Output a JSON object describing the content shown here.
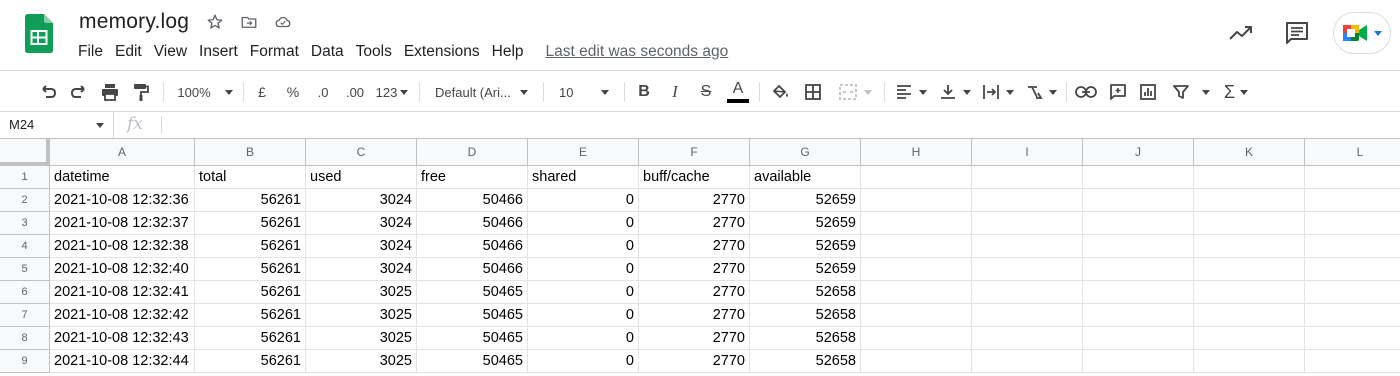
{
  "document": {
    "title": "memory.log",
    "last_edit": "Last edit was seconds ago"
  },
  "menu": [
    "File",
    "Edit",
    "View",
    "Insert",
    "Format",
    "Data",
    "Tools",
    "Extensions",
    "Help"
  ],
  "toolbar": {
    "zoom": "100%",
    "currency": "£",
    "percent": "%",
    "decimal_decrease": ".0",
    "decimal_increase": ".00",
    "more_formats": "123",
    "font": "Default (Ari...",
    "font_size": "10",
    "bold": "B",
    "italic": "I",
    "strikethrough": "S",
    "text_color_glyph": "A",
    "sum_glyph": "Σ"
  },
  "formula_bar": {
    "name_box": "M24",
    "fx_label": "fx",
    "content": ""
  },
  "sheet": {
    "columns": [
      "A",
      "B",
      "C",
      "D",
      "E",
      "F",
      "G",
      "H",
      "I",
      "J",
      "K",
      "L"
    ],
    "rows": [
      {
        "num": "1",
        "cells": [
          "datetime",
          "total",
          "used",
          "free",
          "shared",
          "buff/cache",
          "available"
        ]
      },
      {
        "num": "2",
        "cells": [
          "2021-10-08 12:32:36",
          "56261",
          "3024",
          "50466",
          "0",
          "2770",
          "52659"
        ]
      },
      {
        "num": "3",
        "cells": [
          "2021-10-08 12:32:37",
          "56261",
          "3024",
          "50466",
          "0",
          "2770",
          "52659"
        ]
      },
      {
        "num": "4",
        "cells": [
          "2021-10-08 12:32:38",
          "56261",
          "3024",
          "50466",
          "0",
          "2770",
          "52659"
        ]
      },
      {
        "num": "5",
        "cells": [
          "2021-10-08 12:32:40",
          "56261",
          "3024",
          "50466",
          "0",
          "2770",
          "52659"
        ]
      },
      {
        "num": "6",
        "cells": [
          "2021-10-08 12:32:41",
          "56261",
          "3025",
          "50465",
          "0",
          "2770",
          "52658"
        ]
      },
      {
        "num": "7",
        "cells": [
          "2021-10-08 12:32:42",
          "56261",
          "3025",
          "50465",
          "0",
          "2770",
          "52658"
        ]
      },
      {
        "num": "8",
        "cells": [
          "2021-10-08 12:32:43",
          "56261",
          "3025",
          "50465",
          "0",
          "2770",
          "52658"
        ]
      },
      {
        "num": "9",
        "cells": [
          "2021-10-08 12:32:44",
          "56261",
          "3025",
          "50465",
          "0",
          "2770",
          "52658"
        ]
      }
    ]
  },
  "colors": {
    "sheets_green": "#0f9d58",
    "grid_line": "#e2e3e3",
    "header_bg": "#f8f9fa"
  },
  "icons": [
    "star-icon",
    "move-to-folder-icon",
    "cloud-status-icon",
    "activity-trend-icon",
    "comments-icon",
    "meet-icon"
  ]
}
